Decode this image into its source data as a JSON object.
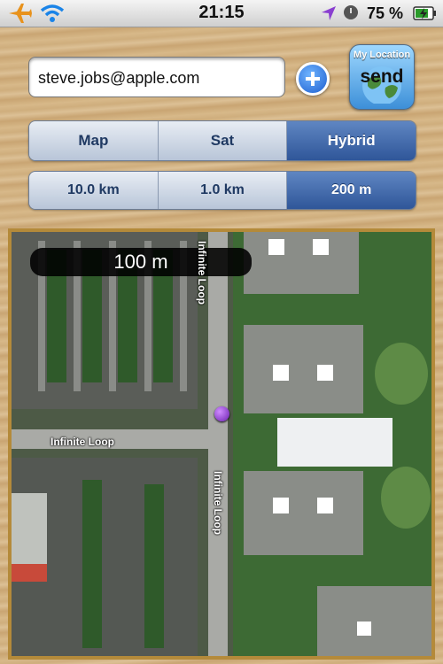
{
  "status_bar": {
    "time": "21:15",
    "battery": "75 %",
    "icons": [
      "airplane-icon",
      "wifi-icon",
      "location-arrow-icon",
      "clock-icon",
      "battery-charging-icon"
    ]
  },
  "email": {
    "value": "steve.jobs@apple.com"
  },
  "add_button": {
    "icon": "plus-circle-icon"
  },
  "send_button": {
    "top_label": "My Location",
    "label": "send"
  },
  "map_type": {
    "options": [
      "Map",
      "Sat",
      "Hybrid"
    ],
    "selected": "Hybrid"
  },
  "scale": {
    "options": [
      "10.0 km",
      "1.0 km",
      "200 m"
    ],
    "selected": "200 m"
  },
  "map": {
    "scale_label": "100 m",
    "road_labels": [
      "Infinite Loop",
      "Infinite Loop",
      "Infinite Loop"
    ],
    "pin_color": "#7a2bc4"
  },
  "colors": {
    "accent": "#2f5699",
    "frame": "#b48a3a"
  }
}
